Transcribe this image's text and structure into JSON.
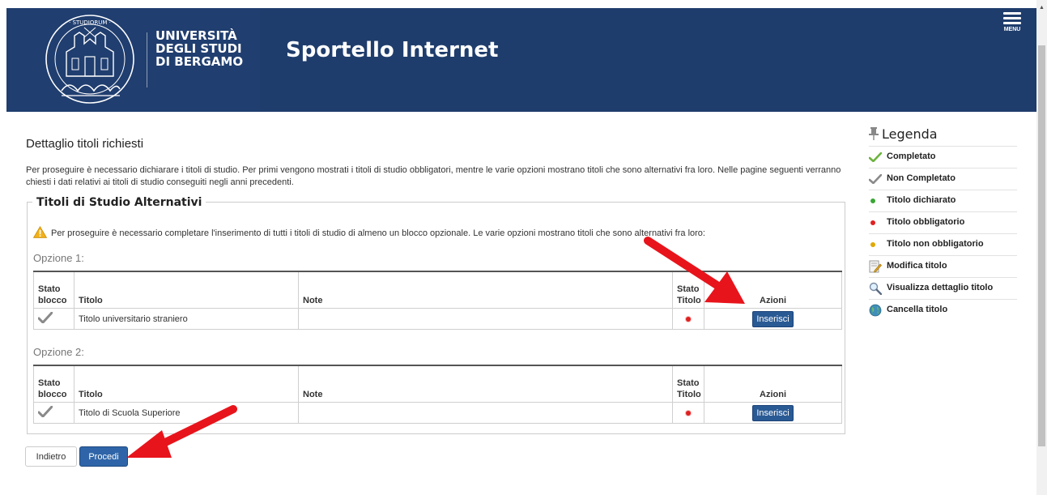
{
  "header": {
    "university_line1": "UNIVERSITÀ",
    "university_line2": "DEGLI STUDI",
    "university_line3": "DI BERGAMO",
    "app_title": "Sportello Internet",
    "menu_label": "MENU",
    "background_color": "#1f3d6c"
  },
  "page": {
    "title": "Dettaglio titoli richiesti",
    "intro": "Per proseguire è necessario dichiarare i titoli di studio. Per primi vengono mostrati i titoli di studio obbligatori, mentre le varie opzioni mostrano titoli che sono alternativi fra loro. Nelle pagine seguenti verranno chiesti i dati relativi ai titoli di studio conseguiti negli anni precedenti."
  },
  "section": {
    "title": "Titoli di Studio Alternativi",
    "warning": "Per proseguire è necessario completare l'inserimento di tutti i titoli di studio di almeno un blocco opzionale. Le varie opzioni mostrano titoli che sono alternativi fra loro:"
  },
  "table_headers": {
    "stato_blocco_1": "Stato",
    "stato_blocco_2": "blocco",
    "titolo": "Titolo",
    "note": "Note",
    "stato_titolo_1": "Stato",
    "stato_titolo_2": "Titolo",
    "azioni": "Azioni"
  },
  "options": [
    {
      "label": "Opzione 1:",
      "rows": [
        {
          "titolo": "Titolo universitario straniero",
          "note": "",
          "action": "Inserisci"
        }
      ]
    },
    {
      "label": "Opzione 2:",
      "rows": [
        {
          "titolo": "Titolo di Scuola Superiore",
          "note": "",
          "action": "Inserisci"
        }
      ]
    }
  ],
  "buttons": {
    "back": "Indietro",
    "next": "Procedi"
  },
  "legend": {
    "title": "Legenda",
    "items": [
      {
        "label": "Completato",
        "icon": "check-green-icon"
      },
      {
        "label": "Non Completato",
        "icon": "check-gray-icon"
      },
      {
        "label": "Titolo dichiarato",
        "icon": "dot-green-icon",
        "color": "#3aa635"
      },
      {
        "label": "Titolo obbligatorio",
        "icon": "dot-red-icon",
        "color": "#e02020"
      },
      {
        "label": "Titolo non obbligatorio",
        "icon": "dot-yellow-icon",
        "color": "#e0a800"
      },
      {
        "label": "Modifica titolo",
        "icon": "edit-icon"
      },
      {
        "label": "Visualizza dettaglio titolo",
        "icon": "magnifier-icon"
      },
      {
        "label": "Cancella titolo",
        "icon": "globe-icon"
      }
    ]
  },
  "colors": {
    "button_primary": "#2f65a8",
    "action_button": "#2a5a94",
    "annotation_arrow": "#e8141b"
  }
}
